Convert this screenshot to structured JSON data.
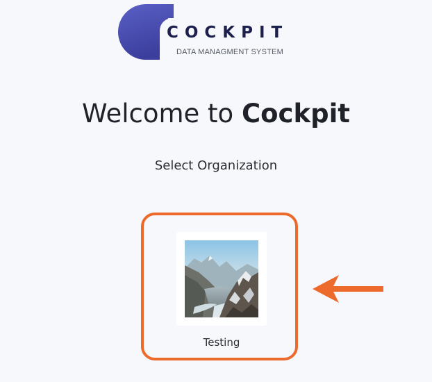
{
  "logo": {
    "wordmark": "COCKPIT",
    "subtitle": "DATA MANAGMENT SYSTEM",
    "colors": {
      "shape_top": "#5a5fc4",
      "shape_bottom": "#3c3f9e",
      "wordmark": "#1d1f4c"
    }
  },
  "welcome": {
    "prefix": "Welcome to ",
    "brand": "Cockpit"
  },
  "select_prompt": "Select Organization",
  "organizations": [
    {
      "name": "Testing",
      "thumbnail": "mountain-landscape-image"
    }
  ],
  "annotation": {
    "color": "#ec6a2b",
    "arrow_direction": "left"
  }
}
